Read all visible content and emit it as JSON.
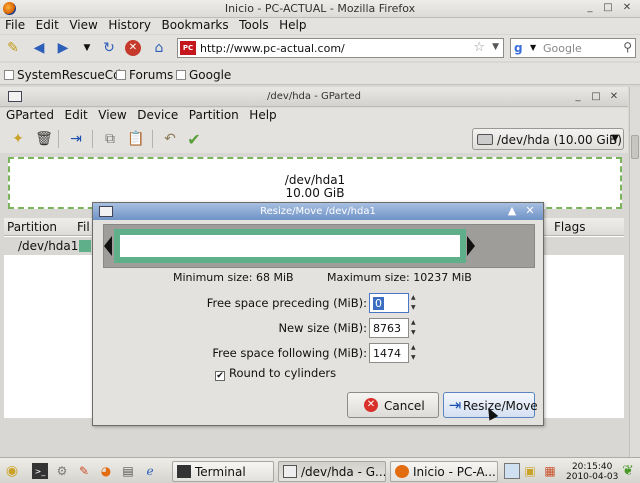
{
  "firefox": {
    "title": "Inicio - PC-ACTUAL - Mozilla Firefox",
    "menu": [
      "File",
      "Edit",
      "View",
      "History",
      "Bookmarks",
      "Tools",
      "Help"
    ],
    "url": "http://www.pc-actual.com/",
    "site_badge": "PC",
    "search_placeholder": "Google",
    "search_engine_letter": "g",
    "bookmarks": [
      "SystemRescueCd",
      "Forums",
      "Google"
    ]
  },
  "gparted": {
    "title": "/dev/hda - GParted",
    "menu": [
      "GParted",
      "Edit",
      "View",
      "Device",
      "Partition",
      "Help"
    ],
    "device_selector": "/dev/hda  (10.00 GiB)",
    "diskmap": {
      "name": "/dev/hda1",
      "size": "10.00 GiB"
    },
    "table": {
      "headers": [
        "Partition",
        "Fil",
        "Flags"
      ],
      "rows": [
        {
          "partition": "/dev/hda1"
        }
      ]
    }
  },
  "dialog": {
    "title": "Resize/Move /dev/hda1",
    "min_size": "Minimum size: 68 MiB",
    "max_size": "Maximum size: 10237 MiB",
    "fields": [
      {
        "label": "Free space preceding (MiB):",
        "value": "0"
      },
      {
        "label": "New size (MiB):",
        "value": "8763"
      },
      {
        "label": "Free space following (MiB):",
        "value": "1474"
      }
    ],
    "round_cylinders_label": "Round to cylinders",
    "round_cylinders_checked": true,
    "cancel_label": "Cancel",
    "resize_label": "Resize/Move"
  },
  "taskbar": {
    "tasks": [
      "Terminal",
      "/dev/hda - G...",
      "Inicio - PC-A..."
    ],
    "time": "20:15:40",
    "date": "2010-04-03"
  },
  "colors": {
    "partition_green": "#5fb08a",
    "dialog_title_blue": "#6f93c7",
    "cancel_red": "#d8312a"
  }
}
